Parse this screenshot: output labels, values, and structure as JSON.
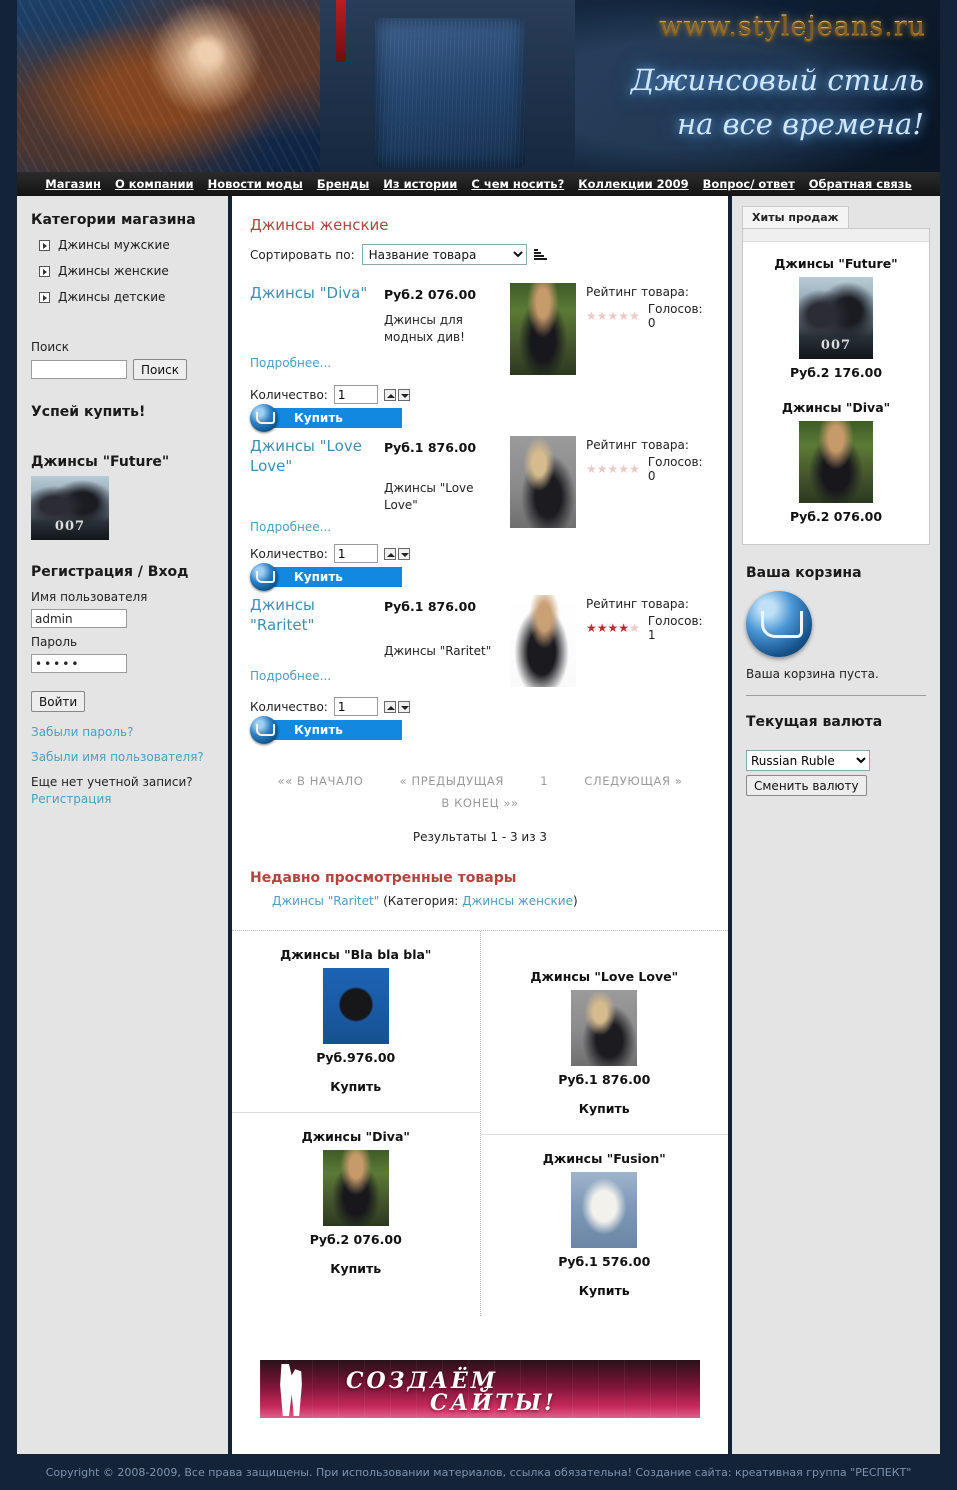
{
  "site": {
    "url": "www.stylejeans.ru",
    "tagline_line1": "Джинсовый стиль",
    "tagline_line2": "на все времена!"
  },
  "nav": {
    "items": [
      "Магазин",
      "О компании",
      "Новости моды",
      "Бренды",
      "Из истории",
      "С чем носить?",
      "Коллекции 2009",
      "Вопрос/ ответ",
      "Обратная связь"
    ]
  },
  "left_sidebar": {
    "categories_title": "Категории магазина",
    "categories": [
      "Джинсы мужские",
      "Джинсы женские",
      "Джинсы детские"
    ],
    "search_title": "Поиск",
    "search_value": "",
    "search_placeholder": "",
    "search_button": "Поиск",
    "promo_title": "Успей купить!",
    "promo_product_name": "Джинсы \"Future\"",
    "login_title": "Регистрация / Вход",
    "username_label": "Имя пользователя",
    "username_value": "admin",
    "password_label": "Пароль",
    "password_value": "•••••",
    "login_button": "Войти",
    "forgot_password": "Забыли пароль?",
    "forgot_username": "Забыли имя пользователя?",
    "no_account_text": "Еще нет учетной записи?",
    "register_link": "Регистрация"
  },
  "main": {
    "category_title": "Джинсы женские",
    "sort_label": "Сортировать по:",
    "sort_selected": "Название товара",
    "sort_options": [
      "Название товара"
    ],
    "qty_label": "Количество:",
    "more_label": "Подробнее...",
    "buy_label": "Купить",
    "rating_label": "Рейтинг товара:",
    "votes_label": "Голосов:",
    "products": [
      {
        "name": "Джинсы \"Diva\"",
        "price": "Руб.2 076.00",
        "description": "Джинсы для модных див!",
        "quantity": "1",
        "rating": 0,
        "votes": "0",
        "image": "img-diva"
      },
      {
        "name": "Джинсы \"Love Love\"",
        "price": "Руб.1 876.00",
        "description": "Джинсы \"Love Love\"",
        "quantity": "1",
        "rating": 0,
        "votes": "0",
        "image": "img-love"
      },
      {
        "name": "Джинсы \"Raritet\"",
        "price": "Руб.1 876.00",
        "description": "Джинсы \"Raritet\"",
        "quantity": "1",
        "rating": 4,
        "votes": "1",
        "image": "img-raritet"
      }
    ],
    "pager": {
      "first": "««  В НАЧАЛО",
      "prev": "«  ПРЕДЫДУЩАЯ",
      "current": "1",
      "next": "СЛЕДУЮЩАЯ  »",
      "last": "В КОНЕЦ  »»"
    },
    "results_text": "Результаты 1 - 3 из 3",
    "recent_title": "Недавно просмотренные товары",
    "recent_item_name": "Джинсы \"Raritet\"",
    "recent_category_label": "(Категория:",
    "recent_category_name": "Джинсы женские",
    "recent_category_close": ")",
    "featured_buy_label": "Купить",
    "featured": [
      {
        "name": "Джинсы \"Bla bla bla\"",
        "price": "Руб.976.00",
        "image": "img-bla"
      },
      {
        "name": "Джинсы \"Love Love\"",
        "price": "Руб.1 876.00",
        "image": "img-love"
      },
      {
        "name": "Джинсы \"Diva\"",
        "price": "Руб.2 076.00",
        "image": "img-diva"
      },
      {
        "name": "Джинсы \"Fusion\"",
        "price": "Руб.1 576.00",
        "image": "img-fusion"
      }
    ],
    "banner": {
      "text1": "СОЗДАЁМ",
      "text2": "САЙТЫ!"
    }
  },
  "right_sidebar": {
    "tab_label": "Хиты продаж",
    "hits": [
      {
        "name": "Джинсы \"Future\"",
        "price": "Руб.2 176.00",
        "image": "img-007"
      },
      {
        "name": "Джинсы \"Diva\"",
        "price": "Руб.2 076.00",
        "image": "img-diva"
      }
    ],
    "cart_title": "Ваша корзина",
    "cart_empty": "Ваша корзина пуста.",
    "currency_title": "Текущая валюта",
    "currency_selected": "Russian Ruble",
    "currency_options": [
      "Russian Ruble"
    ],
    "currency_button": "Сменить валюту"
  },
  "footer": {
    "copyright": "Copyright © 2008-2009, Все права защищены. При использовании материалов, ссылка обязательна! Создание сайта: креативная группа \"РЕСПЕКТ\""
  },
  "colors": {
    "accent_red": "#b5423c",
    "link_blue": "#4a9ec4",
    "buy_blue": "#1288e0",
    "page_dark": "#132438",
    "gold": "#d9ab52"
  }
}
